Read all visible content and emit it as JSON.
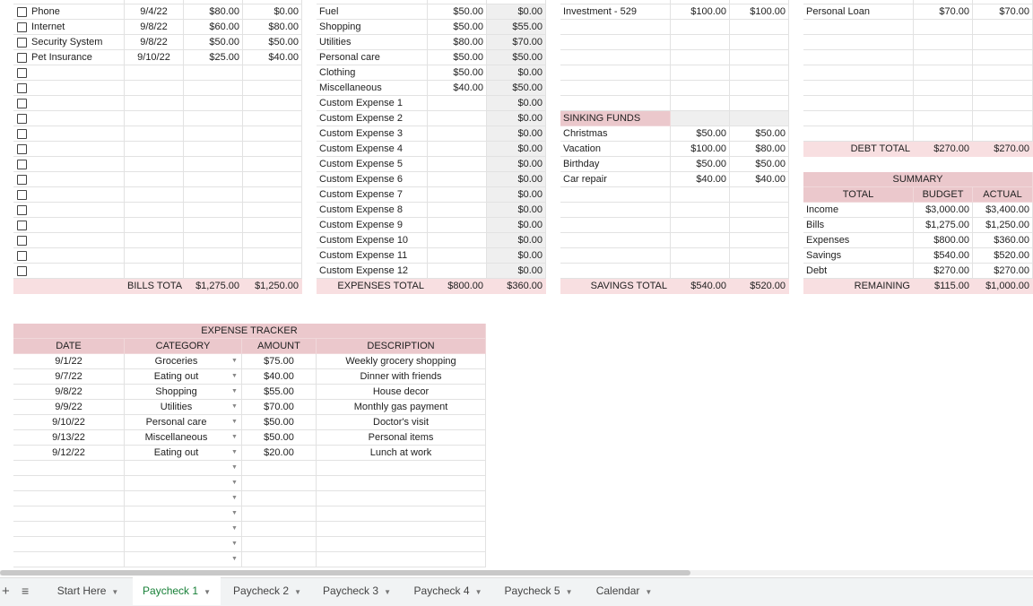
{
  "bills": {
    "rows": [
      {
        "name": "Phone",
        "date": "9/4/22",
        "budget": "$80.00",
        "actual": "$0.00"
      },
      {
        "name": "Internet",
        "date": "9/8/22",
        "budget": "$60.00",
        "actual": "$80.00"
      },
      {
        "name": "Security System",
        "date": "9/8/22",
        "budget": "$50.00",
        "actual": "$50.00"
      },
      {
        "name": "Pet Insurance",
        "date": "9/10/22",
        "budget": "$25.00",
        "actual": "$40.00"
      }
    ],
    "total_label": "BILLS TOTAL",
    "total_budget": "$1,275.00",
    "total_actual": "$1,250.00"
  },
  "expenses": {
    "rows": [
      {
        "name": "Fuel",
        "budget": "$50.00",
        "actual": "$0.00"
      },
      {
        "name": "Shopping",
        "budget": "$50.00",
        "actual": "$55.00"
      },
      {
        "name": "Utilities",
        "budget": "$80.00",
        "actual": "$70.00"
      },
      {
        "name": "Personal care",
        "budget": "$50.00",
        "actual": "$50.00"
      },
      {
        "name": "Clothing",
        "budget": "$50.00",
        "actual": "$0.00"
      },
      {
        "name": "Miscellaneous",
        "budget": "$40.00",
        "actual": "$50.00"
      },
      {
        "name": "Custom Expense 1",
        "budget": "",
        "actual": "$0.00"
      },
      {
        "name": "Custom Expense 2",
        "budget": "",
        "actual": "$0.00"
      },
      {
        "name": "Custom Expense 3",
        "budget": "",
        "actual": "$0.00"
      },
      {
        "name": "Custom Expense 4",
        "budget": "",
        "actual": "$0.00"
      },
      {
        "name": "Custom Expense 5",
        "budget": "",
        "actual": "$0.00"
      },
      {
        "name": "Custom Expense 6",
        "budget": "",
        "actual": "$0.00"
      },
      {
        "name": "Custom Expense 7",
        "budget": "",
        "actual": "$0.00"
      },
      {
        "name": "Custom Expense 8",
        "budget": "",
        "actual": "$0.00"
      },
      {
        "name": "Custom Expense 9",
        "budget": "",
        "actual": "$0.00"
      },
      {
        "name": "Custom Expense 10",
        "budget": "",
        "actual": "$0.00"
      },
      {
        "name": "Custom Expense 11",
        "budget": "",
        "actual": "$0.00"
      },
      {
        "name": "Custom Expense 12",
        "budget": "",
        "actual": "$0.00"
      }
    ],
    "total_label": "EXPENSES TOTAL",
    "total_budget": "$800.00",
    "total_actual": "$360.00"
  },
  "savings": {
    "rows": [
      {
        "name": "Investment - 529",
        "budget": "$100.00",
        "actual": "$100.00"
      }
    ],
    "sinking_label": "SINKING FUNDS",
    "sinking": [
      {
        "name": "Christmas",
        "budget": "$50.00",
        "actual": "$50.00"
      },
      {
        "name": "Vacation",
        "budget": "$100.00",
        "actual": "$80.00"
      },
      {
        "name": "Birthday",
        "budget": "$50.00",
        "actual": "$50.00"
      },
      {
        "name": "Car repair",
        "budget": "$40.00",
        "actual": "$40.00"
      }
    ],
    "total_label": "SAVINGS TOTAL",
    "total_budget": "$540.00",
    "total_actual": "$520.00"
  },
  "debt": {
    "rows": [
      {
        "name": "Personal Loan",
        "budget": "$70.00",
        "actual": "$70.00"
      }
    ],
    "total_label": "DEBT TOTAL",
    "total_budget": "$270.00",
    "total_actual": "$270.00"
  },
  "summary": {
    "title": "SUMMARY",
    "headers": [
      "TOTAL",
      "BUDGET",
      "ACTUAL"
    ],
    "rows": [
      {
        "name": "Income",
        "budget": "$3,000.00",
        "actual": "$3,400.00"
      },
      {
        "name": "Bills",
        "budget": "$1,275.00",
        "actual": "$1,250.00"
      },
      {
        "name": "Expenses",
        "budget": "$800.00",
        "actual": "$360.00"
      },
      {
        "name": "Savings",
        "budget": "$540.00",
        "actual": "$520.00"
      },
      {
        "name": "Debt",
        "budget": "$270.00",
        "actual": "$270.00"
      }
    ],
    "remaining_label": "REMAINING",
    "remaining_budget": "$115.00",
    "remaining_actual": "$1,000.00"
  },
  "tracker": {
    "title": "EXPENSE TRACKER",
    "headers": [
      "DATE",
      "CATEGORY",
      "AMOUNT",
      "DESCRIPTION"
    ],
    "rows": [
      {
        "date": "9/1/22",
        "category": "Groceries",
        "amount": "$75.00",
        "description": "Weekly grocery shopping"
      },
      {
        "date": "9/7/22",
        "category": "Eating out",
        "amount": "$40.00",
        "description": "Dinner with friends"
      },
      {
        "date": "9/8/22",
        "category": "Shopping",
        "amount": "$55.00",
        "description": "House decor"
      },
      {
        "date": "9/9/22",
        "category": "Utilities",
        "amount": "$70.00",
        "description": "Monthly gas payment"
      },
      {
        "date": "9/10/22",
        "category": "Personal care",
        "amount": "$50.00",
        "description": "Doctor's visit"
      },
      {
        "date": "9/13/22",
        "category": "Miscellaneous",
        "amount": "$50.00",
        "description": "Personal items"
      },
      {
        "date": "9/12/22",
        "category": "Eating out",
        "amount": "$20.00",
        "description": "Lunch at work"
      }
    ]
  },
  "sheet_tabs": {
    "add": "+",
    "menu": "≡",
    "active": "Paycheck 1",
    "tabs": [
      "Start Here",
      "Paycheck 1",
      "Paycheck 2",
      "Paycheck 3",
      "Paycheck 4",
      "Paycheck 5",
      "Calendar"
    ]
  },
  "colors": {
    "header_pink": "#ebc8cc",
    "total_pink": "#f8dfe1",
    "active_tab": "#188038"
  }
}
